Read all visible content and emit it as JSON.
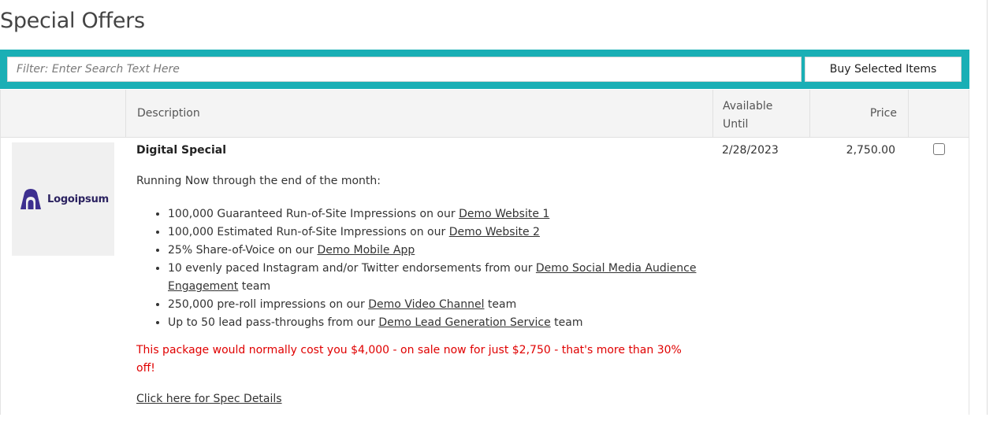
{
  "page": {
    "title": "Special Offers"
  },
  "filter": {
    "placeholder": "Filter: Enter Search Text Here",
    "value": ""
  },
  "buy_button": {
    "label": "Buy Selected Items"
  },
  "colors": {
    "accent": "#1aafb5",
    "sale_text": "#e00000"
  },
  "table": {
    "headers": {
      "image": "",
      "description": "Description",
      "available_until": "Available Until",
      "price": "Price",
      "select": ""
    },
    "rows": [
      {
        "logo": {
          "text": "Logoipsum",
          "icon": "logo-mark-icon"
        },
        "title": "Digital Special",
        "intro": "Running Now through the end of the month:",
        "features": [
          {
            "before": "100,000 Guaranteed Run-of-Site Impressions on our ",
            "link": "Demo Website 1",
            "after": ""
          },
          {
            "before": "100,000 Estimated Run-of-Site Impressions on our ",
            "link": "Demo Website 2",
            "after": ""
          },
          {
            "before": "25% Share-of-Voice on our ",
            "link": "Demo Mobile App",
            "after": ""
          },
          {
            "before": "10 evenly paced Instagram and/or Twitter endorsements from our ",
            "link": "Demo Social Media Audience Engagement",
            "after": " team"
          },
          {
            "before": "250,000 pre-roll impressions on our ",
            "link": "Demo Video Channel",
            "after": " team"
          },
          {
            "before": "Up to 50 lead pass-throughs from our ",
            "link": "Demo Lead Generation Service",
            "after": " team"
          }
        ],
        "sale_note": "This package would normally cost you $4,000 - on sale now for just $2,750 - that's more than 30% off!",
        "spec_link": "Click here for Spec Details",
        "available_until": "2/28/2023",
        "price": "2,750.00",
        "selected": false
      }
    ]
  }
}
